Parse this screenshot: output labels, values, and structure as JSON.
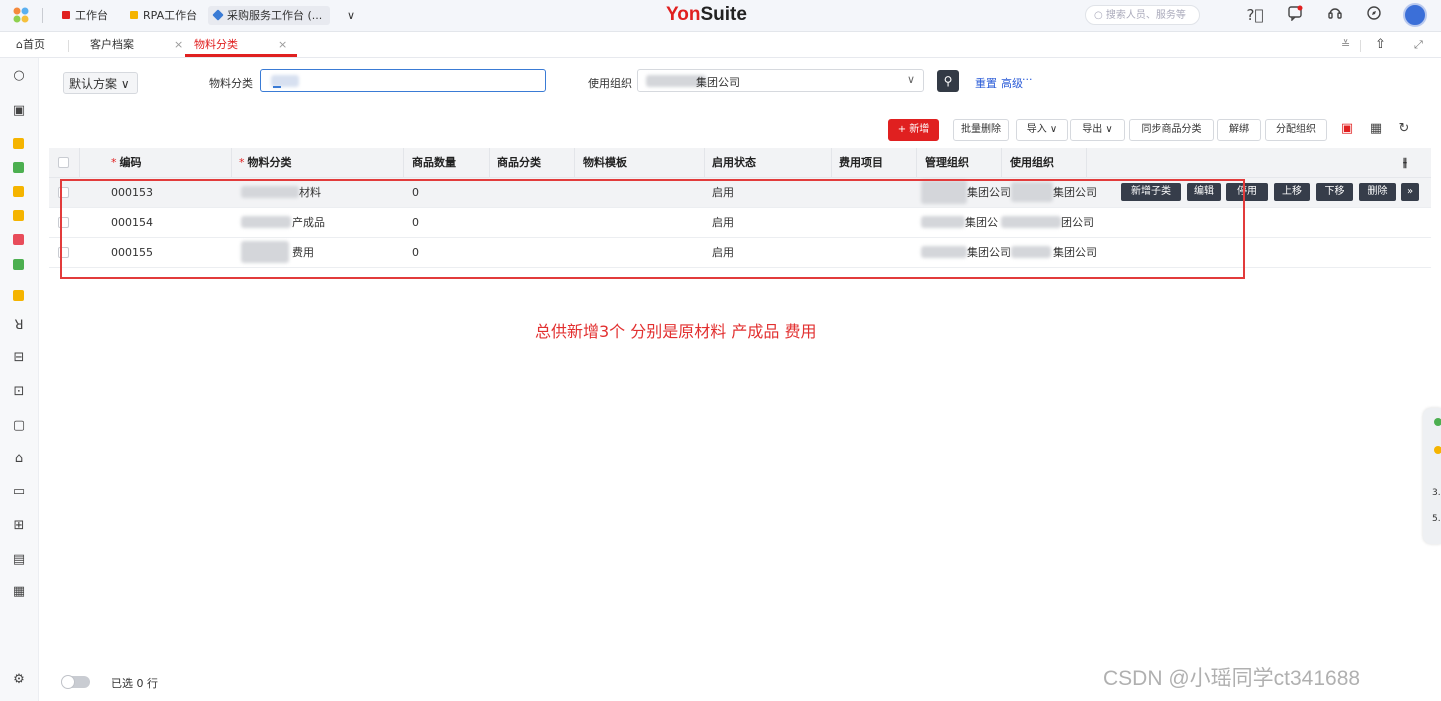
{
  "app": {
    "brand_yon": "Yon",
    "brand_suite": "Suite",
    "tabs": [
      {
        "label": "工作台",
        "color": "#e02020"
      },
      {
        "label": "RPA工作台",
        "color": "#f5b400"
      },
      {
        "label": "采购服务工作台 (...",
        "color": "#3a7bd5"
      }
    ],
    "tabs_more": "∨",
    "search_placeholder": "搜索人员、服务等"
  },
  "page_tabs": {
    "home": "首页",
    "tabs": [
      {
        "label": "客户档案",
        "close": "×"
      },
      {
        "label": "物料分类",
        "close": "×"
      }
    ]
  },
  "filter": {
    "scheme": "默认方案",
    "scheme_caret": "∨",
    "material_category_label": "物料分类",
    "use_org_label": "使用组织",
    "use_org_value": "集团公司",
    "use_org_caret": "∨",
    "reset": "重置",
    "advanced": "高级",
    "more": "···"
  },
  "toolbar": {
    "add": "+ 新增",
    "batch_delete": "批量删除",
    "import": "导入",
    "export": "导出",
    "sync": "同步商品分类",
    "unbind": "解绑",
    "assign_org": "分配组织",
    "caret": "∨"
  },
  "table": {
    "columns": [
      "编码",
      "物料分类",
      "商品数量",
      "商品分类",
      "物料模板",
      "启用状态",
      "费用项目",
      "管理组织",
      "使用组织"
    ],
    "required_mark": "*",
    "rows": [
      {
        "code": "000153",
        "name": "材料",
        "qty": "0",
        "status": "启用",
        "mgmt_org": "集团公司",
        "use_org": "集团公司"
      },
      {
        "code": "000154",
        "name": "产成品",
        "qty": "0",
        "status": "启用",
        "mgmt_org": "集团公",
        "use_org": "团公司"
      },
      {
        "code": "000155",
        "name": "费用",
        "qty": "0",
        "status": "启用",
        "mgmt_org": "集团公司",
        "use_org": "集团公司"
      }
    ],
    "row_actions": [
      "新增子类",
      "编辑",
      "停用",
      "上移",
      "下移",
      "删除",
      "»"
    ]
  },
  "annotation": "总供新增3个 分别是原材料 产成品 费用",
  "footer": {
    "selected": "已选 0 行"
  },
  "watermark": "CSDN @小瑶同学ct341688",
  "float_panel": {
    "v1": "3.",
    "v2": "5."
  },
  "colors": {
    "accent": "#e02020",
    "dark_button": "#363d4a",
    "link": "#2a5bd7",
    "annotation": "#e23030"
  }
}
